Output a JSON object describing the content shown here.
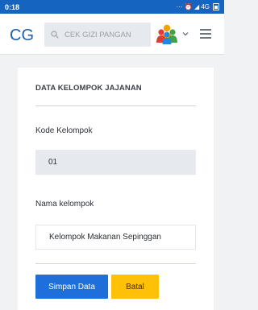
{
  "status_bar": {
    "time": "0:18",
    "indicators": "··· ⏰ ◢ 4G"
  },
  "app_bar": {
    "logo": "CG",
    "search_placeholder": "CEK GIZI PANGAN"
  },
  "form": {
    "title": "DATA KELOMPOK JAJANAN",
    "kode_label": "Kode Kelompok",
    "kode_value": "01",
    "nama_label": "Nama kelompok",
    "nama_value": "Kelompok Makanan Sepinggan",
    "save_label": "Simpan Data",
    "cancel_label": "Batal"
  },
  "colors": {
    "status_bar": "#1565c0",
    "primary": "#1e6fd9",
    "warning": "#ffc107",
    "logo": "#1f5fa6"
  }
}
